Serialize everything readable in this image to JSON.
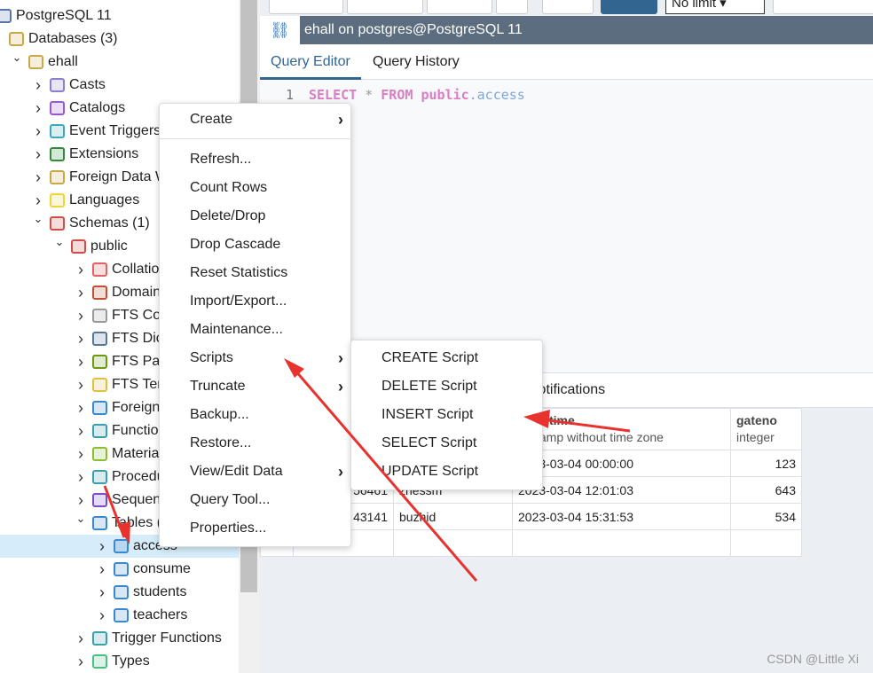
{
  "tree": [
    {
      "label": "PostgreSQL 11",
      "level": 0,
      "toggle": "",
      "icon": "server-icon",
      "color": "#5577aa"
    },
    {
      "label": "Databases (3)",
      "level": 1,
      "toggle": "",
      "icon": "databases-icon",
      "color": "#c8a84a"
    },
    {
      "label": "ehall",
      "level": 2,
      "toggle": "open",
      "icon": "database-icon",
      "color": "#c8a84a"
    },
    {
      "label": "Casts",
      "level": 3,
      "toggle": "closed",
      "icon": "casts-icon",
      "color": "#8a7fd8"
    },
    {
      "label": "Catalogs",
      "level": 3,
      "toggle": "closed",
      "icon": "catalogs-icon",
      "color": "#9b59d0"
    },
    {
      "label": "Event Triggers",
      "level": 3,
      "toggle": "closed",
      "icon": "event-triggers-icon",
      "color": "#3aa8c0"
    },
    {
      "label": "Extensions",
      "level": 3,
      "toggle": "closed",
      "icon": "extensions-icon",
      "color": "#2f8a3a"
    },
    {
      "label": "Foreign Data W",
      "level": 3,
      "toggle": "closed",
      "icon": "foreign-data-wrapper-icon",
      "color": "#c8a84a"
    },
    {
      "label": "Languages",
      "level": 3,
      "toggle": "closed",
      "icon": "languages-icon",
      "color": "#f2d33a"
    },
    {
      "label": "Schemas (1)",
      "level": 3,
      "toggle": "open",
      "icon": "schemas-icon",
      "color": "#d24b4b"
    },
    {
      "label": "public",
      "level": 4,
      "toggle": "open",
      "icon": "schema-icon",
      "color": "#d24b4b"
    },
    {
      "label": "Collatio",
      "level": 5,
      "toggle": "closed",
      "icon": "collations-icon",
      "color": "#e86060"
    },
    {
      "label": "Domain",
      "level": 5,
      "toggle": "closed",
      "icon": "domains-icon",
      "color": "#c05030"
    },
    {
      "label": "FTS Co",
      "level": 5,
      "toggle": "closed",
      "icon": "fts-configurations-icon",
      "color": "#999999"
    },
    {
      "label": "FTS Dic",
      "level": 5,
      "toggle": "closed",
      "icon": "fts-dictionaries-icon",
      "color": "#557799"
    },
    {
      "label": "FTS Par",
      "level": 5,
      "toggle": "closed",
      "icon": "fts-parsers-icon",
      "color": "#6a9a10"
    },
    {
      "label": "FTS Ter",
      "level": 5,
      "toggle": "closed",
      "icon": "fts-templates-icon",
      "color": "#e0c040"
    },
    {
      "label": "Foreign",
      "level": 5,
      "toggle": "closed",
      "icon": "foreign-tables-icon",
      "color": "#3a88d0"
    },
    {
      "label": "Functio",
      "level": 5,
      "toggle": "closed",
      "icon": "functions-icon",
      "color": "#3aa0b0"
    },
    {
      "label": "Materia",
      "level": 5,
      "toggle": "closed",
      "icon": "materialized-views-icon",
      "color": "#8ac030"
    },
    {
      "label": "Procedu",
      "level": 5,
      "toggle": "closed",
      "icon": "procedures-icon",
      "color": "#3aa0b0"
    },
    {
      "label": "Sequen",
      "level": 5,
      "toggle": "closed",
      "icon": "sequences-icon",
      "color": "#7a4ad0"
    },
    {
      "label": "Tables (",
      "level": 5,
      "toggle": "open",
      "icon": "tables-icon",
      "color": "#3a88d0"
    },
    {
      "label": "access",
      "level": 6,
      "toggle": "closed",
      "icon": "table-icon",
      "color": "#3a88d0",
      "selected": true
    },
    {
      "label": "consume",
      "level": 6,
      "toggle": "closed",
      "icon": "table-icon",
      "color": "#3a88d0"
    },
    {
      "label": "students",
      "level": 6,
      "toggle": "closed",
      "icon": "table-icon",
      "color": "#3a88d0"
    },
    {
      "label": "teachers",
      "level": 6,
      "toggle": "closed",
      "icon": "table-icon",
      "color": "#3a88d0"
    },
    {
      "label": "Trigger Functions",
      "level": 5,
      "toggle": "closed",
      "icon": "trigger-functions-icon",
      "color": "#3aa0b0"
    },
    {
      "label": "Types",
      "level": 5,
      "toggle": "closed",
      "icon": "types-icon",
      "color": "#4ac080"
    }
  ],
  "toolbar": {
    "limit_select": "No limit"
  },
  "title": "ehall on postgres@PostgreSQL 11",
  "tabs": [
    {
      "label": "Query Editor",
      "active": true
    },
    {
      "label": "Query History"
    }
  ],
  "editor": {
    "line": "1",
    "kw1": "SELECT",
    "star": "*",
    "kw2": "FROM",
    "schema": "public",
    "dot": ".",
    "table": "access"
  },
  "results": {
    "tab": "Notifications",
    "columns": [
      {
        "name": "",
        "type": ""
      },
      {
        "name": "",
        "type": ""
      },
      {
        "name": "",
        "type": ""
      },
      {
        "name": "time",
        "type": "stamp without time zone"
      },
      {
        "name": "gateno",
        "type": "integer"
      }
    ],
    "rows": [
      [
        "",
        "",
        "",
        "2023-03-04 00:00:00",
        "123"
      ],
      [
        "",
        "56461",
        "zhessm",
        "2023-03-04 12:01:03",
        "643"
      ],
      [
        "",
        "43141",
        "buzhid",
        "2023-03-04 15:31:53",
        "534"
      ],
      [
        "",
        "",
        "",
        "",
        ""
      ]
    ]
  },
  "context_menu": {
    "items": [
      {
        "label": "Create",
        "submenu": true,
        "sep_after": true
      },
      {
        "label": "Refresh..."
      },
      {
        "label": "Count Rows"
      },
      {
        "label": "Delete/Drop"
      },
      {
        "label": "Drop Cascade"
      },
      {
        "label": "Reset Statistics"
      },
      {
        "label": "Import/Export..."
      },
      {
        "label": "Maintenance..."
      },
      {
        "label": "Scripts",
        "submenu": true
      },
      {
        "label": "Truncate",
        "submenu": true
      },
      {
        "label": "Backup..."
      },
      {
        "label": "Restore..."
      },
      {
        "label": "View/Edit Data",
        "submenu": true
      },
      {
        "label": "Query Tool..."
      },
      {
        "label": "Properties..."
      }
    ]
  },
  "scripts_submenu": {
    "items": [
      {
        "label": "CREATE Script"
      },
      {
        "label": "DELETE Script"
      },
      {
        "label": "INSERT Script"
      },
      {
        "label": "SELECT Script"
      },
      {
        "label": "UPDATE Script"
      }
    ]
  },
  "annotation_color": "#e8322e",
  "watermark": "CSDN @Little Xi"
}
